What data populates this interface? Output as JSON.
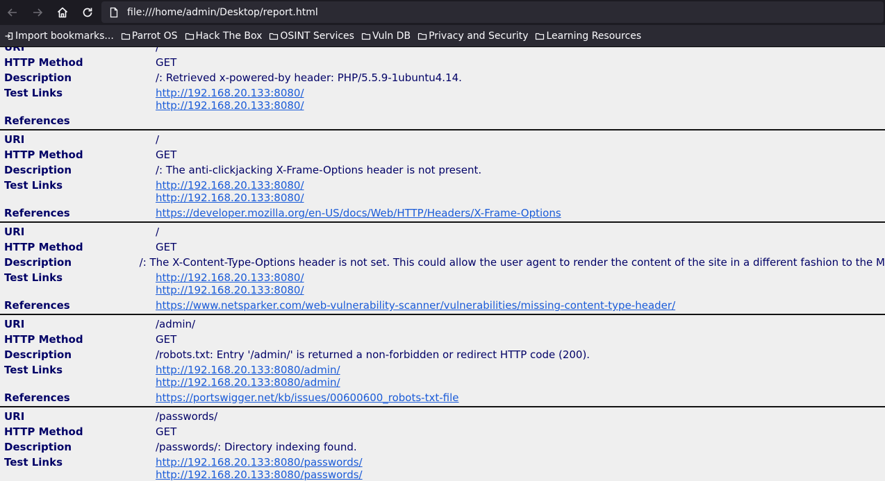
{
  "browser": {
    "url": "file:///home/admin/Desktop/report.html",
    "bookmarks": [
      {
        "label": "Import bookmarks...",
        "icon": "import-icon"
      },
      {
        "label": "Parrot OS",
        "icon": "folder-icon"
      },
      {
        "label": "Hack The Box",
        "icon": "folder-icon"
      },
      {
        "label": "OSINT Services",
        "icon": "folder-icon"
      },
      {
        "label": "Vuln DB",
        "icon": "folder-icon"
      },
      {
        "label": "Privacy and Security",
        "icon": "folder-icon"
      },
      {
        "label": "Learning Resources",
        "icon": "folder-icon"
      }
    ]
  },
  "labels": {
    "uri": "URI",
    "method": "HTTP Method",
    "description": "Description",
    "test_links": "Test Links",
    "references": "References"
  },
  "entries": [
    {
      "uri": "/",
      "method": "GET",
      "description": "/: Retrieved x-powered-by header: PHP/5.5.9-1ubuntu4.14.",
      "test_links": [
        "http://192.168.20.133:8080/",
        "http://192.168.20.133:8080/"
      ],
      "reference": ""
    },
    {
      "uri": "/",
      "method": "GET",
      "description": "/: The anti-clickjacking X-Frame-Options header is not present.",
      "test_links": [
        "http://192.168.20.133:8080/",
        "http://192.168.20.133:8080/"
      ],
      "reference": "https://developer.mozilla.org/en-US/docs/Web/HTTP/Headers/X-Frame-Options"
    },
    {
      "uri": "/",
      "method": "GET",
      "description": "/: The X-Content-Type-Options header is not set. This could allow the user agent to render the content of the site in a different fashion to the M",
      "test_links": [
        "http://192.168.20.133:8080/",
        "http://192.168.20.133:8080/"
      ],
      "reference": "https://www.netsparker.com/web-vulnerability-scanner/vulnerabilities/missing-content-type-header/"
    },
    {
      "uri": "/admin/",
      "method": "GET",
      "description": "/robots.txt: Entry '/admin/' is returned a non-forbidden or redirect HTTP code (200).",
      "test_links": [
        "http://192.168.20.133:8080/admin/",
        "http://192.168.20.133:8080/admin/"
      ],
      "reference": "https://portswigger.net/kb/issues/00600600_robots-txt-file"
    },
    {
      "uri": "/passwords/",
      "method": "GET",
      "description": "/passwords/: Directory indexing found.",
      "test_links": [
        "http://192.168.20.133:8080/passwords/",
        "http://192.168.20.133:8080/passwords/"
      ],
      "reference": ""
    }
  ]
}
